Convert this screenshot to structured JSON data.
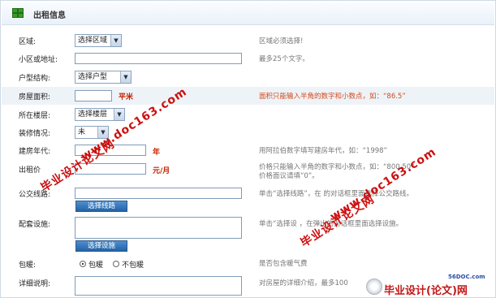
{
  "header": {
    "title": "出租信息"
  },
  "fields": {
    "region": {
      "label": "区域:",
      "value": "选择区域",
      "hint": "区域必须选择!"
    },
    "address": {
      "label": "小区或地址:",
      "value": "",
      "hint": "最多25个文字。"
    },
    "layout": {
      "label": "户型结构:",
      "value": "选择户型"
    },
    "area": {
      "label": "房屋面积:",
      "value": "",
      "unit": "平米",
      "hint": "面积只能输入半角的数字和小数点，如：“86.5”"
    },
    "floor": {
      "label": "所在楼层:",
      "value": "选择楼层"
    },
    "decoration": {
      "label": "装修情况:",
      "value": "未"
    },
    "build_year": {
      "label": "建房年代:",
      "value": "",
      "unit": "年",
      "hint": "用阿拉伯数字填写建房年代，如：“1998”"
    },
    "rent": {
      "label": "出租价",
      "value": "",
      "unit": "元/月",
      "hint": "价格只能输入半角的数字和小数点，如：“800.50”",
      "hint2": "价格面议请填“0”。"
    },
    "bus": {
      "label": "公交线路:",
      "value": "",
      "button": "选择线路",
      "hint": "单击“选择线路”，在 的对话框里面选择公交路线。"
    },
    "facilities": {
      "label": "配套设施:",
      "value": "",
      "button": "选择设施",
      "hint": "单击“选择设       ，在弹出的对话框里面选择设施。"
    },
    "heating": {
      "label": "包暖:",
      "options": [
        "包暖",
        "不包暖"
      ],
      "selected": "包暖",
      "hint": "是否包含暖气费"
    },
    "description": {
      "label": "详细说明:",
      "value": "",
      "hint": "对房屋的详细介绍，最多100"
    }
  },
  "watermarks": [
    "毕业设计论文网",
    "www.doc163.com",
    "毕业设计论文网",
    "www.doc163.com",
    "毕业设计论文网",
    "www.doc163.com"
  ],
  "logo": {
    "site": "56DOC.com",
    "name": "毕业设计(论文)网"
  },
  "colors": {
    "accent": "#2363a6",
    "watermark": "#cc1010",
    "hint_red": "#d44a1a"
  }
}
